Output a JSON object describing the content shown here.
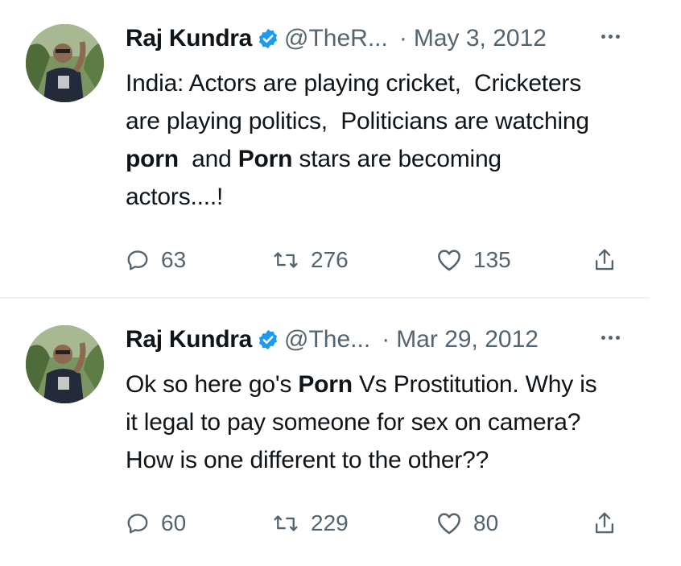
{
  "tweets": [
    {
      "author": "Raj Kundra",
      "handle": "@TheR...",
      "separator": "·",
      "date": "May 3, 2012",
      "lines": [
        [
          {
            "t": "India: Actors are playing cricket,  Cricketers",
            "b": false
          }
        ],
        [
          {
            "t": "are playing politics,  Politicians are watching",
            "b": false
          }
        ],
        [
          {
            "t": "porn",
            "b": true
          },
          {
            "t": "  and ",
            "b": false
          },
          {
            "t": "Porn",
            "b": true
          },
          {
            "t": " stars are becoming",
            "b": false
          }
        ],
        [
          {
            "t": "actors....!",
            "b": false
          }
        ]
      ],
      "replies": "63",
      "retweets": "276",
      "likes": "135"
    },
    {
      "author": "Raj Kundra",
      "handle": "@The...",
      "separator": "·",
      "date": "Mar 29, 2012",
      "lines": [
        [
          {
            "t": "Ok so here go's ",
            "b": false
          },
          {
            "t": "Porn",
            "b": true
          },
          {
            "t": " Vs Prostitution. Why is",
            "b": false
          }
        ],
        [
          {
            "t": "it legal to pay someone for sex on camera?",
            "b": false
          }
        ],
        [
          {
            "t": "How is one different to the other??",
            "b": false
          }
        ]
      ],
      "replies": "60",
      "retweets": "229",
      "likes": "80"
    }
  ],
  "icons": {
    "verified": "verified-badge-icon",
    "more": "more-options-icon",
    "reply": "reply-icon",
    "retweet": "retweet-icon",
    "like": "heart-icon",
    "share": "share-icon"
  },
  "colors": {
    "text": "#0f1419",
    "secondary": "#536471",
    "verified": "#1d9bf0",
    "divider": "#eff3f4"
  }
}
